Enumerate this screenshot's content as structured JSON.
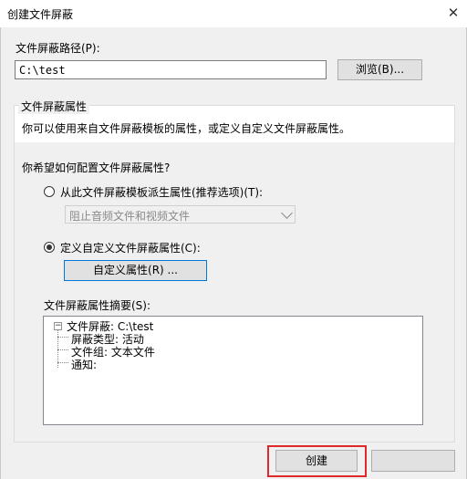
{
  "window": {
    "title": "创建文件屏蔽",
    "close_glyph": "✕"
  },
  "path": {
    "label": "文件屏蔽路径(P):",
    "value": "C:\\test",
    "browse_label": "浏览(B)..."
  },
  "properties": {
    "group_label": "文件屏蔽属性",
    "description": "你可以使用来自文件屏蔽模板的属性，或定义自定义文件屏蔽属性。",
    "question": "你希望如何配置文件屏蔽属性?",
    "option_template": {
      "label": "从此文件屏蔽模板派生属性(推荐选项)(T):",
      "selected": false
    },
    "template_select_value": "阻止音频文件和视频文件",
    "option_custom": {
      "label": "定义自定义文件屏蔽属性(C):",
      "selected": true
    },
    "custom_button_label": "自定义属性(R) ..."
  },
  "summary": {
    "label": "文件屏蔽属性摘要(S):",
    "tree": {
      "root": "文件屏蔽: C:\\test",
      "children": [
        "屏蔽类型: 活动",
        "文件组: 文本文件",
        "通知:"
      ]
    }
  },
  "footer": {
    "create_label": "创建"
  },
  "colors": {
    "highlight_red": "#e0282a",
    "focus_blue": "#0078d7"
  }
}
